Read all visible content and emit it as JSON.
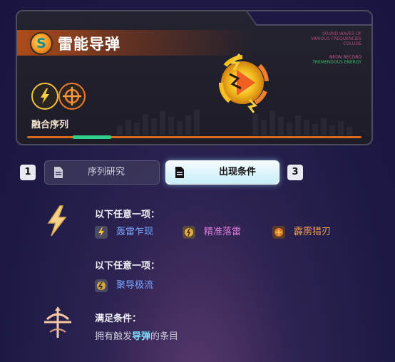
{
  "skill": {
    "title": "雷能导弹",
    "fusion_label": "融合序列",
    "info_lines": [
      "SOUND WAVES OF",
      "VARIOUS FREQUENCIES",
      "COLLIDE",
      "NEON RECORD",
      "TREMENDOUS ENERGY"
    ]
  },
  "tabs": {
    "left_number": "1",
    "right_number": "3",
    "items": [
      {
        "label": "序列研究",
        "active": false
      },
      {
        "label": "出现条件",
        "active": true
      }
    ]
  },
  "conditions": [
    {
      "title": "以下任意一项：",
      "items": [
        {
          "label": "轰雷乍现",
          "color": "#7aa4ff"
        },
        {
          "label": "精准落雷",
          "color": "#e07ad8"
        },
        {
          "label": "霹雳猎刃",
          "color": "#f0a050"
        }
      ]
    },
    {
      "title": "以下任意一项：",
      "items": [
        {
          "label": "聚导极流",
          "color": "#7aa4ff"
        }
      ]
    },
    {
      "title": "满足条件：",
      "desc_before": "拥有触发",
      "desc_highlight": "导弹",
      "desc_after": "的条目"
    }
  ],
  "icons": [
    "skill-badge-icon",
    "lightning-icon",
    "crosshair-icon",
    "document-icon",
    "lightning-missile-icon"
  ]
}
